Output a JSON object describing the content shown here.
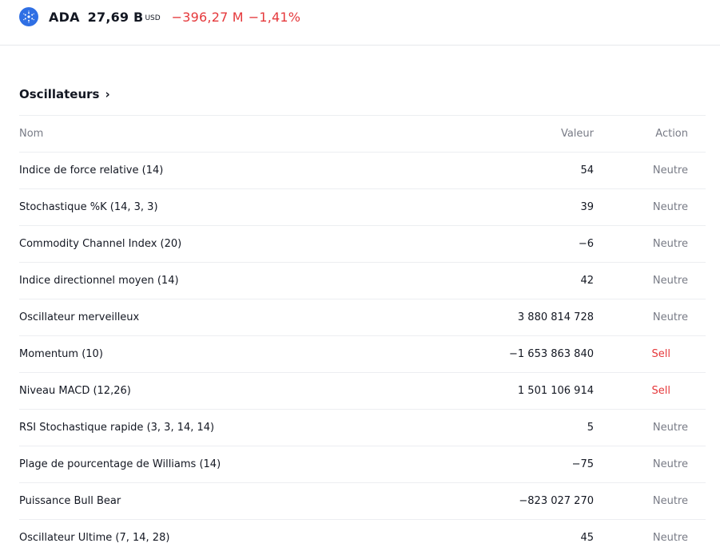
{
  "ticker": {
    "symbol": "ADA",
    "market_cap": "27,69 B",
    "currency": "USD",
    "change_abs": "−396,27 M",
    "change_pct": "−1,41%",
    "accent_color": "#2f6fe4",
    "negative_color": "#e5383b",
    "logo_icon": "cardano-icon"
  },
  "section": {
    "title": "Oscillateurs",
    "chevron": "›"
  },
  "table": {
    "headers": {
      "name": "Nom",
      "value": "Valeur",
      "action": "Action"
    },
    "rows": [
      {
        "name": "Indice de force relative (14)",
        "value": "54",
        "action": "Neutre"
      },
      {
        "name": "Stochastique %K (14, 3, 3)",
        "value": "39",
        "action": "Neutre"
      },
      {
        "name": "Commodity Channel Index (20)",
        "value": "−6",
        "action": "Neutre"
      },
      {
        "name": "Indice directionnel moyen (14)",
        "value": "42",
        "action": "Neutre"
      },
      {
        "name": "Oscillateur merveilleux",
        "value": "3 880 814 728",
        "action": "Neutre"
      },
      {
        "name": "Momentum (10)",
        "value": "−1 653 863 840",
        "action": "Sell"
      },
      {
        "name": "Niveau MACD (12,26)",
        "value": "1 501 106 914",
        "action": "Sell"
      },
      {
        "name": "RSI Stochastique rapide (3, 3, 14, 14)",
        "value": "5",
        "action": "Neutre"
      },
      {
        "name": "Plage de pourcentage de Williams (14)",
        "value": "−75",
        "action": "Neutre"
      },
      {
        "name": "Puissance Bull Bear",
        "value": "−823 027 270",
        "action": "Neutre"
      },
      {
        "name": "Oscillateur Ultime (7, 14, 28)",
        "value": "45",
        "action": "Neutre"
      }
    ]
  }
}
